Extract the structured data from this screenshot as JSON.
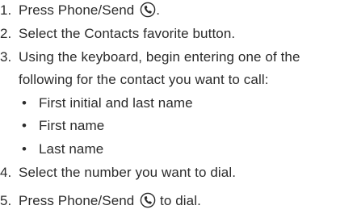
{
  "steps": [
    {
      "number": "1.",
      "text_before": "Press Phone/Send",
      "icon": "phone-send-icon",
      "text_after": "."
    },
    {
      "number": "2.",
      "text": "Select the Contacts favorite button."
    },
    {
      "number": "3.",
      "text": "Using the keyboard, begin entering one of the",
      "continuation": "following for the contact you want to call:",
      "bullets": [
        "First initial and last name",
        "First name",
        "Last name"
      ]
    },
    {
      "number": "4.",
      "text": "Select the number you want to dial."
    },
    {
      "number": "5.",
      "text_before": "Press Phone/Send",
      "icon": "phone-send-icon",
      "text_after": "to dial."
    }
  ],
  "bullet_glyph": "•"
}
